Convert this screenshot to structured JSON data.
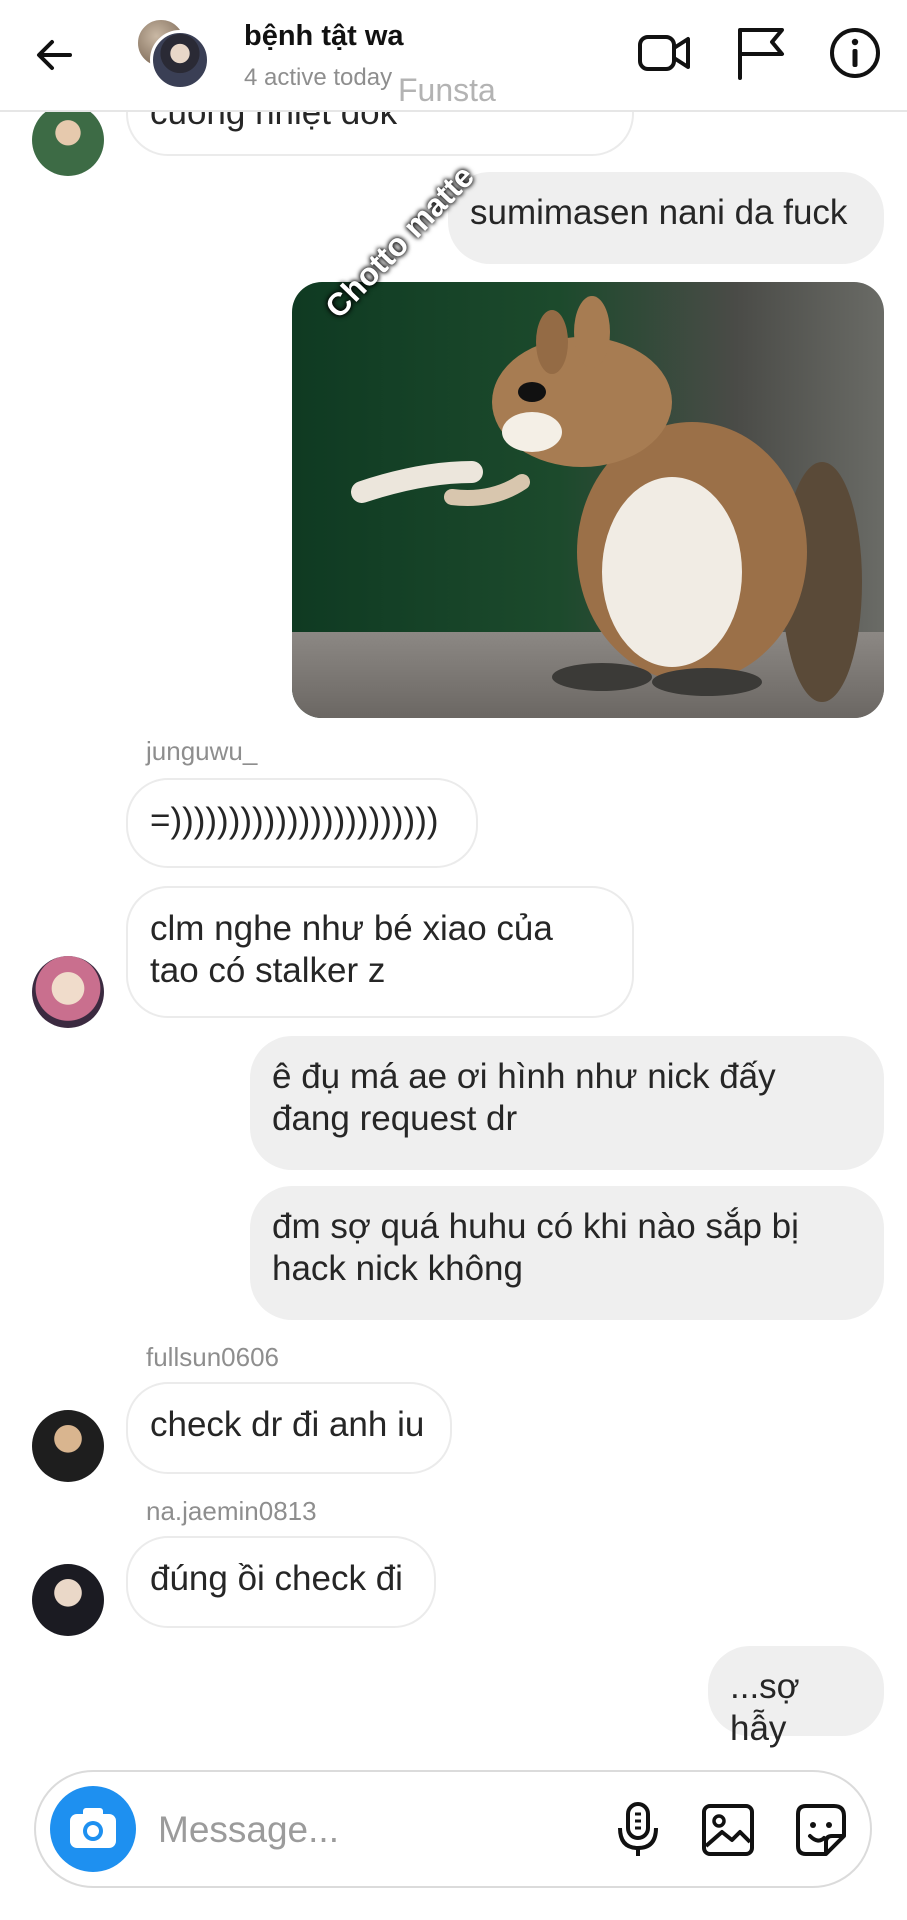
{
  "header": {
    "back_icon": "arrow-left-icon",
    "title": "bệnh tật wa",
    "subtitle": "4 active today",
    "watermark": "Funsta",
    "icons": [
      "video-call-icon",
      "flag-icon",
      "info-icon"
    ]
  },
  "messages": [
    {
      "type": "in",
      "text": "cuồng nhiệt dok"
    },
    {
      "type": "out",
      "text": "sumimasen nani da fuck"
    },
    {
      "type": "image",
      "caption": "Chotto matte"
    },
    {
      "type": "sender",
      "text": "junguwu_"
    },
    {
      "type": "in",
      "text": "=)))))))))))))))))))))))"
    },
    {
      "type": "in",
      "text": "clm nghe như bé xiao của\ntao có stalker z"
    },
    {
      "type": "out",
      "text": "ê đụ má ae ơi hình như nick đấy\nđang request dr"
    },
    {
      "type": "out",
      "text": "đm sợ quá huhu có khi nào sắp bị\nhack nick không"
    },
    {
      "type": "sender",
      "text": "fullsun0606"
    },
    {
      "type": "in",
      "text": "check dr đi anh iu"
    },
    {
      "type": "sender",
      "text": "na.jaemin0813"
    },
    {
      "type": "in",
      "text": "đúng ồi check đi"
    },
    {
      "type": "out",
      "text": "...sợ hẫy"
    }
  ],
  "composer": {
    "placeholder": "Message...",
    "icons": [
      "camera-icon",
      "microphone-icon",
      "gallery-icon",
      "sticker-icon"
    ],
    "accent": "#1e90f0"
  },
  "colors": {
    "outgoing_bubble": "#efefef",
    "incoming_border": "#ebebeb",
    "secondary_text": "#8e8e8e"
  }
}
